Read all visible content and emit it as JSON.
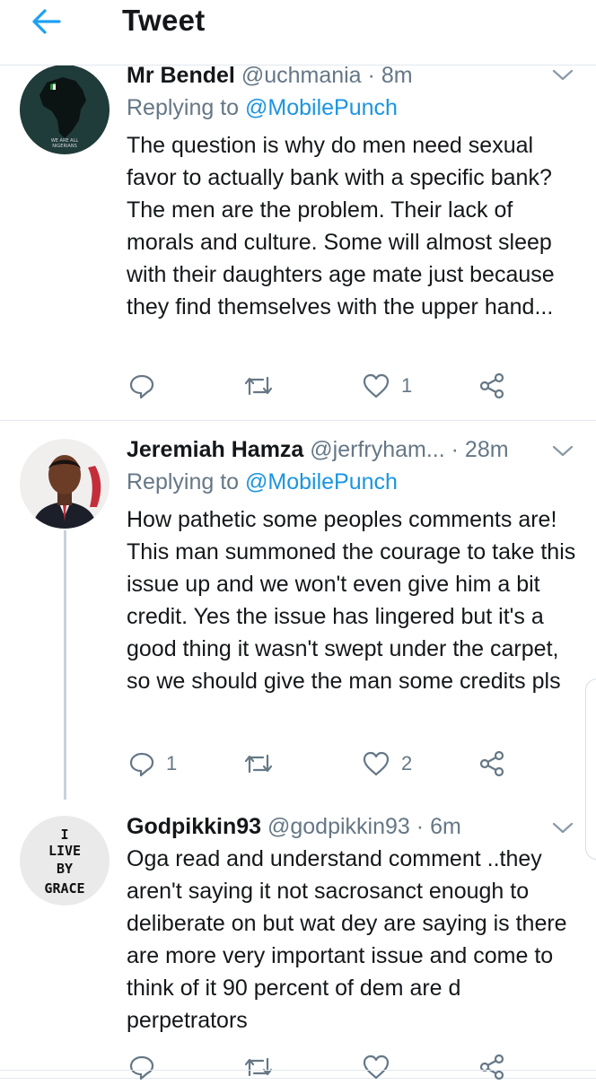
{
  "header": {
    "title": "Tweet",
    "back_icon": "arrow-left-icon",
    "accent": "#1da1f2"
  },
  "tweets": [
    {
      "name": "Mr Bendel",
      "handle": "@uchmania",
      "time": "8m",
      "replying_label": "Replying to",
      "replying_to": "@MobilePunch",
      "body": "The question is why do men need sexual favor to actually bank with a specific bank? The men are the problem. Their lack of morals and culture. Some will almost sleep with their daughters age mate just because they find themselves with the upper hand...",
      "reply_count": "",
      "retweet_count": "",
      "like_count": "1",
      "avatar": "africa-map-avatar"
    },
    {
      "name": "Jeremiah Hamza",
      "handle": "@jerfryham...",
      "time": "28m",
      "replying_label": "Replying to",
      "replying_to": "@MobilePunch",
      "body": "How pathetic some peoples comments are! This man summoned the courage to take this issue up and we won't even give him a bit credit. Yes the issue has lingered but it's a good thing it wasn't swept under the carpet, so we should give the man some credits pls",
      "reply_count": "1",
      "retweet_count": "",
      "like_count": "2",
      "avatar": "person-photo-avatar"
    },
    {
      "name": "Godpikkin93",
      "handle": "@godpikkin93",
      "time": "6m",
      "body": "Oga read and understand comment ..they aren't saying it not sacrosanct enough to deliberate on but wat dey are saying is there are more very important issue and come to think of it 90 percent of dem are d perpetrators",
      "reply_count": "",
      "retweet_count": "",
      "like_count": "",
      "avatar": "text-avatar",
      "avatar_text": [
        "I",
        "LIVE",
        "BY",
        "GRACE"
      ]
    }
  ],
  "colors": {
    "text": "#14171a",
    "secondary": "#657786",
    "link": "#1b95e0",
    "divider": "#e1e8ed"
  }
}
